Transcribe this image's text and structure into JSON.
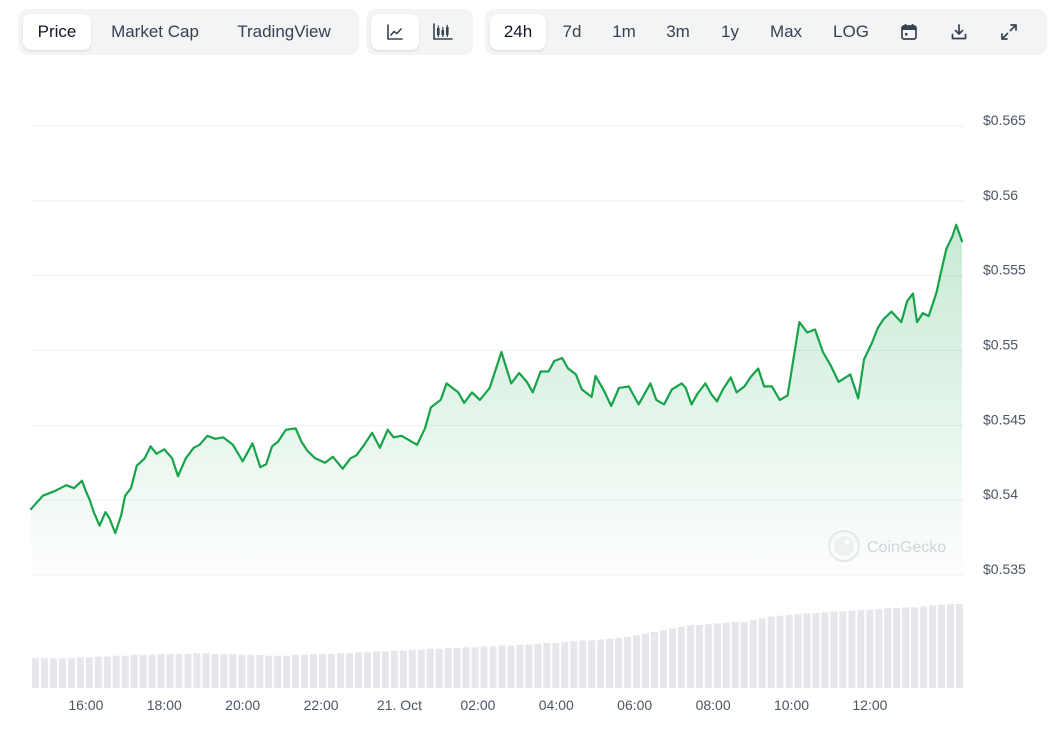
{
  "toolbar": {
    "metric_tabs": [
      {
        "label": "Price",
        "active": true
      },
      {
        "label": "Market Cap",
        "active": false
      },
      {
        "label": "TradingView",
        "active": false
      }
    ],
    "chart_type_icons": [
      {
        "icon": "line-chart-icon",
        "active": true
      },
      {
        "icon": "candlestick-chart-icon",
        "active": false
      }
    ],
    "ranges": [
      {
        "label": "24h",
        "active": true
      },
      {
        "label": "7d",
        "active": false
      },
      {
        "label": "1m",
        "active": false
      },
      {
        "label": "3m",
        "active": false
      },
      {
        "label": "1y",
        "active": false
      },
      {
        "label": "Max",
        "active": false
      },
      {
        "label": "LOG",
        "active": false
      }
    ],
    "action_icons": [
      "calendar-icon",
      "download-icon",
      "expand-icon"
    ]
  },
  "watermark": "CoinGecko",
  "colors": {
    "line": "#16a34a",
    "fill": "#16a34a",
    "volume": "#e5e7eb",
    "grid": "#eef0f2",
    "toolbar_bg": "#f3f4f6"
  },
  "chart_data": {
    "type": "area",
    "title": "",
    "xlabel": "",
    "ylabel": "",
    "x_ticks": [
      "16:00",
      "18:00",
      "20:00",
      "22:00",
      "21. Oct",
      "02:00",
      "04:00",
      "06:00",
      "08:00",
      "10:00",
      "12:00"
    ],
    "y_ticks": [
      "$0.535",
      "$0.54",
      "$0.545",
      "$0.55",
      "$0.555",
      "$0.56",
      "$0.565"
    ],
    "ylim": [
      0.535,
      0.565
    ],
    "x_range_hours": [
      14.6,
      38.4
    ],
    "series": [
      {
        "x": [
          14.6,
          14.9,
          15.2,
          15.5,
          15.7,
          15.9,
          16.0,
          16.1,
          16.2,
          16.35,
          16.5,
          16.6,
          16.75,
          16.9,
          17.0,
          17.15,
          17.3,
          17.5,
          17.65,
          17.8,
          18.0,
          18.2,
          18.35,
          18.55,
          18.75,
          18.9,
          19.1,
          19.3,
          19.5,
          19.75,
          20.0,
          20.25,
          20.45,
          20.6,
          20.75,
          20.9,
          21.1,
          21.35,
          21.5,
          21.65,
          21.85,
          22.1,
          22.3,
          22.55,
          22.75,
          22.9,
          23.1,
          23.3,
          23.5,
          23.7,
          23.85,
          24.05,
          24.25,
          24.45,
          24.65,
          24.8,
          25.05,
          25.2,
          25.5,
          25.65,
          25.85,
          26.05,
          26.3,
          26.6,
          26.85,
          27.05,
          27.25,
          27.4,
          27.6,
          27.8,
          27.95,
          28.15,
          28.3,
          28.5,
          28.65,
          28.9,
          29.0,
          29.2,
          29.4,
          29.6,
          29.85,
          30.1,
          30.4,
          30.55,
          30.75,
          30.95,
          31.2,
          31.3,
          31.45,
          31.6,
          31.8,
          31.95,
          32.1,
          32.25,
          32.45,
          32.6,
          32.8,
          32.95,
          33.15,
          33.3,
          33.5,
          33.7,
          33.9,
          34.2,
          34.4,
          34.6,
          34.8,
          35.0,
          35.2,
          35.5,
          35.7,
          35.85,
          36.05,
          36.2,
          36.35,
          36.55,
          36.8,
          36.95,
          37.1,
          37.2,
          37.35,
          37.5,
          37.7,
          37.8,
          37.95,
          38.1,
          38.2,
          38.35
        ],
        "values": [
          0.5394,
          0.5403,
          0.5406,
          0.541,
          0.5408,
          0.5413,
          0.5406,
          0.54,
          0.5392,
          0.5383,
          0.5392,
          0.5388,
          0.5378,
          0.539,
          0.5403,
          0.5408,
          0.5423,
          0.5428,
          0.5436,
          0.5431,
          0.5434,
          0.5428,
          0.5416,
          0.5428,
          0.5435,
          0.5437,
          0.5443,
          0.5441,
          0.5442,
          0.5437,
          0.5426,
          0.5438,
          0.5422,
          0.5424,
          0.5436,
          0.5439,
          0.5447,
          0.5448,
          0.5439,
          0.5433,
          0.5428,
          0.5425,
          0.5429,
          0.5421,
          0.5428,
          0.543,
          0.5437,
          0.5445,
          0.5435,
          0.5447,
          0.5442,
          0.5443,
          0.544,
          0.5437,
          0.5448,
          0.5462,
          0.5467,
          0.5478,
          0.5472,
          0.5465,
          0.5472,
          0.5467,
          0.5475,
          0.5499,
          0.5478,
          0.5485,
          0.5479,
          0.5472,
          0.5486,
          0.5486,
          0.5493,
          0.5495,
          0.5488,
          0.5484,
          0.5474,
          0.5469,
          0.5483,
          0.5474,
          0.5463,
          0.5475,
          0.5476,
          0.5464,
          0.5478,
          0.5467,
          0.5464,
          0.5474,
          0.5478,
          0.5475,
          0.5464,
          0.5471,
          0.5478,
          0.5471,
          0.5466,
          0.5474,
          0.5482,
          0.5472,
          0.5476,
          0.5482,
          0.5488,
          0.5476,
          0.5476,
          0.5467,
          0.547,
          0.5519,
          0.5512,
          0.5514,
          0.5499,
          0.549,
          0.5479,
          0.5484,
          0.5468,
          0.5494,
          0.5505,
          0.5515,
          0.5521,
          0.5526,
          0.5519,
          0.5533,
          0.5538,
          0.5519,
          0.5525,
          0.5523,
          0.5539,
          0.5551,
          0.5568,
          0.5576,
          0.5584,
          0.5573
        ],
        "volume": [
          0.35,
          0.35,
          0.35,
          0.35,
          0.35,
          0.36,
          0.36,
          0.37,
          0.37,
          0.38,
          0.38,
          0.39,
          0.39,
          0.39,
          0.4,
          0.4,
          0.4,
          0.4,
          0.41,
          0.41,
          0.4,
          0.4,
          0.4,
          0.39,
          0.39,
          0.39,
          0.38,
          0.38,
          0.38,
          0.39,
          0.39,
          0.4,
          0.4,
          0.4,
          0.41,
          0.41,
          0.42,
          0.42,
          0.43,
          0.43,
          0.44,
          0.44,
          0.45,
          0.45,
          0.46,
          0.46,
          0.47,
          0.47,
          0.48,
          0.48,
          0.49,
          0.49,
          0.5,
          0.5,
          0.51,
          0.51,
          0.52,
          0.53,
          0.53,
          0.54,
          0.55,
          0.56,
          0.56,
          0.57,
          0.58,
          0.59,
          0.6,
          0.62,
          0.64,
          0.66,
          0.68,
          0.7,
          0.72,
          0.74,
          0.74,
          0.75,
          0.76,
          0.77,
          0.78,
          0.78,
          0.8,
          0.82,
          0.84,
          0.85,
          0.86,
          0.87,
          0.88,
          0.88,
          0.89,
          0.9,
          0.9,
          0.91,
          0.92,
          0.92,
          0.93,
          0.94,
          0.94,
          0.95,
          0.95,
          0.96,
          0.97,
          0.98,
          0.99,
          0.99
        ]
      }
    ]
  }
}
